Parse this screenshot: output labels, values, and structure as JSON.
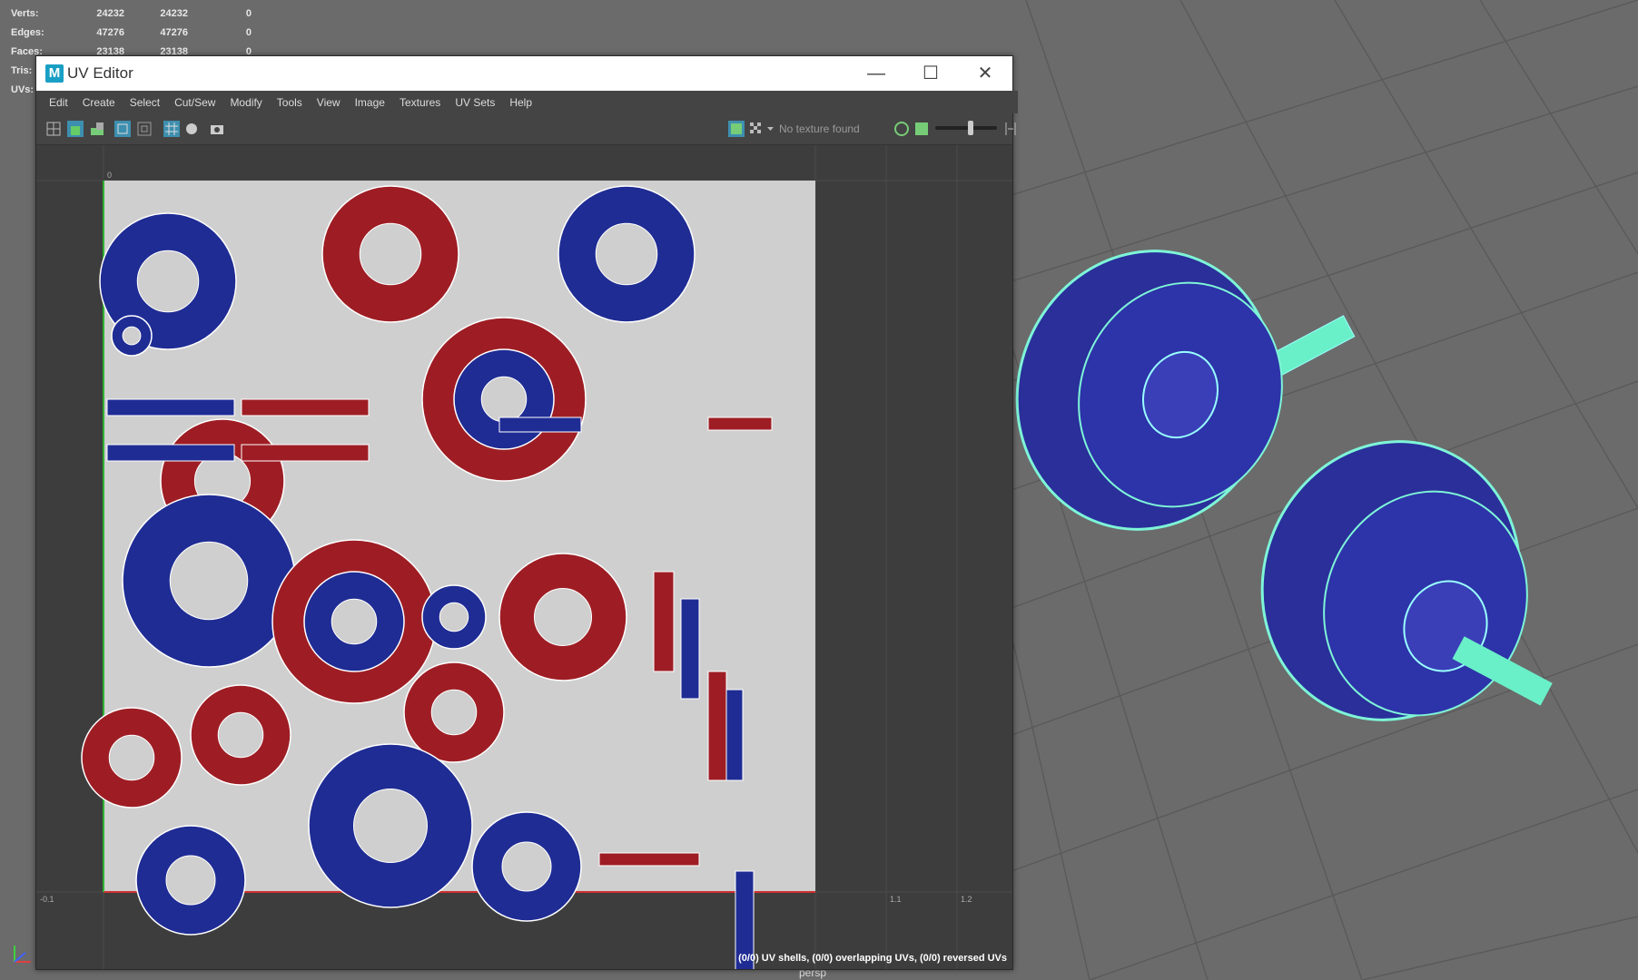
{
  "hud": {
    "rows": [
      {
        "label": "Verts:",
        "v1": "24232",
        "v2": "24232",
        "v3": "0"
      },
      {
        "label": "Edges:",
        "v1": "47276",
        "v2": "47276",
        "v3": "0"
      },
      {
        "label": "Faces:",
        "v1": "23138",
        "v2": "23138",
        "v3": "0"
      },
      {
        "label": "Tris:",
        "v1": "",
        "v2": "",
        "v3": ""
      },
      {
        "label": "UVs:",
        "v1": "",
        "v2": "",
        "v3": ""
      }
    ]
  },
  "viewport": {
    "camera_label": "persp"
  },
  "uv_editor": {
    "app_icon": "M",
    "title": "UV Editor",
    "window_buttons": {
      "minimize": "—",
      "maximize": "☐",
      "close": "✕"
    },
    "menu": [
      "Edit",
      "Create",
      "Select",
      "Cut/Sew",
      "Modify",
      "Tools",
      "View",
      "Image",
      "Textures",
      "UV Sets",
      "Help"
    ],
    "toolbar": {
      "texture_status": "No texture found"
    },
    "axis_labels": {
      "zero": "0",
      "minus": "-0.1",
      "one_one": "1.1",
      "one_two": "1.2"
    },
    "status": "(0/0) UV shells, (0/0) overlapping UVs, (0/0) reversed UVs"
  },
  "colors": {
    "shell_red": "#9e1d24",
    "shell_blue": "#1f2c94",
    "mesh_blue": "#2a2f9a",
    "wire_cyan": "#7ef5d8"
  }
}
